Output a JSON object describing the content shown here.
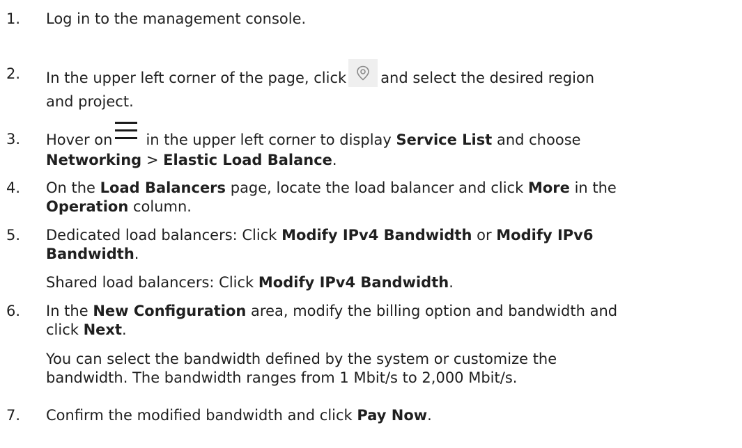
{
  "steps": [
    {
      "num": "1.",
      "parts": {
        "a": "Log in to the management console."
      }
    },
    {
      "num": "2.",
      "parts": {
        "a": "In the upper left corner of the page, click",
        "b": "and select the desired region",
        "c": "and project."
      },
      "icon": "location-pin-icon"
    },
    {
      "num": "3.",
      "parts": {
        "a": "Hover on",
        "b": "in the upper left corner to display",
        "c": "Service List",
        "d": "and choose",
        "e": "Networking",
        "f": ">",
        "g": "Elastic Load Balance",
        "h": "."
      },
      "icon": "menu-icon"
    },
    {
      "num": "4.",
      "parts": {
        "a": "On the",
        "b": "Load Balancers",
        "c": "page, locate the load balancer and click",
        "d": "More",
        "e": "in the",
        "f": "Operation",
        "g": "column."
      }
    },
    {
      "num": "5.",
      "parts": {
        "a": "Dedicated load balancers: Click",
        "b": "Modify IPv4 Bandwidth",
        "c": "or",
        "d": "Modify IPv6",
        "e": "Bandwidth",
        "f": "."
      },
      "sub": {
        "a": "Shared load balancers: Click",
        "b": "Modify IPv4 Bandwidth",
        "c": "."
      }
    },
    {
      "num": "6.",
      "parts": {
        "a": "In the",
        "b": "New Configuration",
        "c": "area, modify the billing option and bandwidth and",
        "d": "click",
        "e": "Next",
        "f": "."
      },
      "sub": {
        "a": "You can select the bandwidth defined by the system or customize the",
        "b": "bandwidth. The bandwidth ranges from 1 Mbit/s to 2,000 Mbit/s."
      }
    },
    {
      "num": "7.",
      "parts": {
        "a": "Confirm the modified bandwidth and click",
        "b": "Pay Now",
        "c": "."
      }
    }
  ]
}
